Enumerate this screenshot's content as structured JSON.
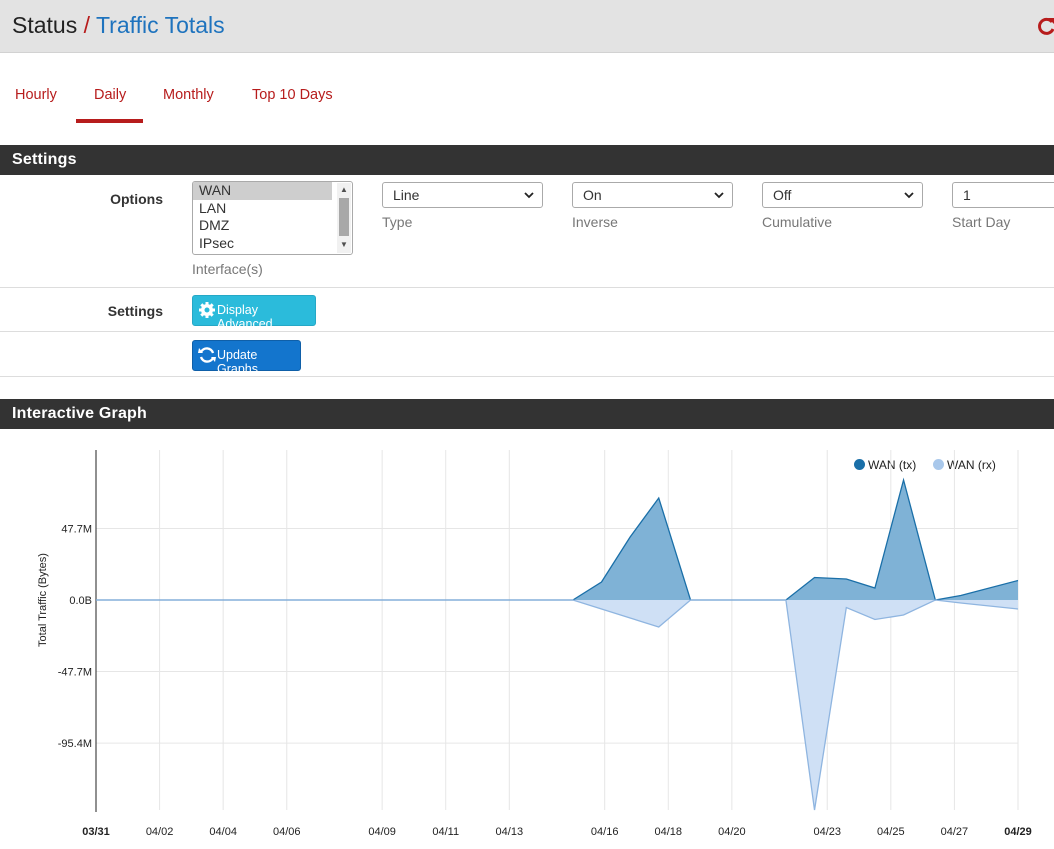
{
  "header": {
    "breadcrumb_root": "Status",
    "separator": "/",
    "page_title": "Traffic Totals",
    "reload_icon": "reload-icon"
  },
  "tabs": [
    {
      "label": "Hourly",
      "active": false
    },
    {
      "label": "Daily",
      "active": true
    },
    {
      "label": "Monthly",
      "active": false
    },
    {
      "label": "Top 10 Days",
      "active": false
    }
  ],
  "settings_panel": {
    "title": "Settings",
    "options_label": "Options",
    "interfaces": [
      "WAN",
      "LAN",
      "DMZ",
      "IPsec"
    ],
    "selected_interface": "WAN",
    "interfaces_label": "Interface(s)",
    "type": {
      "value": "Line",
      "label": "Type"
    },
    "inverse": {
      "value": "On",
      "label": "Inverse"
    },
    "cumulative": {
      "value": "Off",
      "label": "Cumulative"
    },
    "start_day": {
      "value": "1",
      "label": "Start Day"
    },
    "settings_label": "Settings",
    "display_advanced": "Display Advanced",
    "update_graphs": "Update Graphs"
  },
  "graph_panel": {
    "title": "Interactive Graph"
  },
  "colors": {
    "accent_red": "#b71c1c",
    "link_blue": "#1e73be",
    "tx": "#1a6fa8",
    "rx": "#a9c8eb"
  },
  "chart_data": {
    "type": "area",
    "ylabel": "Total Traffic (Bytes)",
    "yticks": [
      "47.7M",
      "0.0B",
      "-47.7M",
      "-95.4M"
    ],
    "ytick_values": [
      47.7,
      0,
      -47.7,
      -95.4
    ],
    "ylim": [
      -140,
      80
    ],
    "xticks": [
      "03/31",
      "04/02",
      "04/04",
      "04/06",
      "04/09",
      "04/11",
      "04/13",
      "04/16",
      "04/18",
      "04/20",
      "04/23",
      "04/25",
      "04/27",
      "04/29"
    ],
    "xtick_days": [
      0,
      2,
      4,
      6,
      9,
      11,
      13,
      16,
      18,
      20,
      23,
      25,
      27,
      29
    ],
    "grid": true,
    "legend_position": "top-right",
    "series": [
      {
        "name": "WAN (tx)",
        "color": "#1a6fa8",
        "x_days": [
          0,
          15.0,
          15.9,
          16.8,
          17.7,
          18.7,
          21.7,
          22.6,
          23.6,
          24.5,
          25.4,
          26.4,
          27.2,
          29
        ],
        "values": [
          0,
          0,
          12,
          42,
          68,
          0,
          0,
          15,
          14,
          8,
          80,
          0,
          3,
          13
        ]
      },
      {
        "name": "WAN (rx)",
        "color": "#a9c8eb",
        "x_days": [
          0,
          15.0,
          15.9,
          16.8,
          17.7,
          18.7,
          21.7,
          22.6,
          23.6,
          24.5,
          25.4,
          26.4,
          27.2,
          29
        ],
        "values": [
          0,
          0,
          -6,
          -12,
          -18,
          0,
          0,
          -140,
          -5,
          -13,
          -10,
          0,
          -2,
          -6
        ]
      }
    ]
  }
}
